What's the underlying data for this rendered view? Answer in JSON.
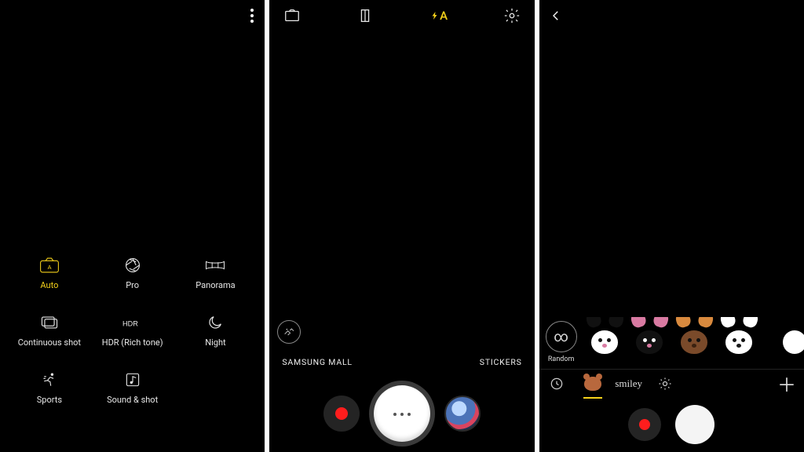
{
  "accent_color": "#f6d21a",
  "panel1": {
    "modes": [
      {
        "id": "auto",
        "label": "Auto",
        "icon": "camera-a-icon",
        "active": true
      },
      {
        "id": "pro",
        "label": "Pro",
        "icon": "aperture-icon",
        "active": false
      },
      {
        "id": "panorama",
        "label": "Panorama",
        "icon": "panorama-icon",
        "active": false
      },
      {
        "id": "continuous",
        "label": "Continuous shot",
        "icon": "burst-icon",
        "active": false
      },
      {
        "id": "hdr",
        "label": "HDR (Rich tone)",
        "icon": "hdr-icon",
        "active": false
      },
      {
        "id": "night",
        "label": "Night",
        "icon": "moon-icon",
        "active": false
      },
      {
        "id": "sports",
        "label": "Sports",
        "icon": "runner-icon",
        "active": false
      },
      {
        "id": "soundshot",
        "label": "Sound & shot",
        "icon": "music-note-icon",
        "active": false
      }
    ]
  },
  "panel2": {
    "flash_label": "A",
    "left_label": "SAMSUNG MALL",
    "right_label": "STICKERS"
  },
  "panel3": {
    "random_label": "Random",
    "script_tab_label": "smiley",
    "stickers": [
      {
        "name": "cat-white-black-ears",
        "face": "#ffffff",
        "ear": "#111",
        "nose": "#d97aa2"
      },
      {
        "name": "cat-black-pink-ears",
        "face": "#111",
        "ear": "#d97aa2",
        "nose": "#d97aa2"
      },
      {
        "name": "deer-antlers",
        "face": "#7a4a2a",
        "ear": "#d98a3e",
        "nose": "#3a2110"
      },
      {
        "name": "bunny-white",
        "face": "#fff",
        "ear": "#fff",
        "nose": "#1a1a1a"
      }
    ]
  }
}
